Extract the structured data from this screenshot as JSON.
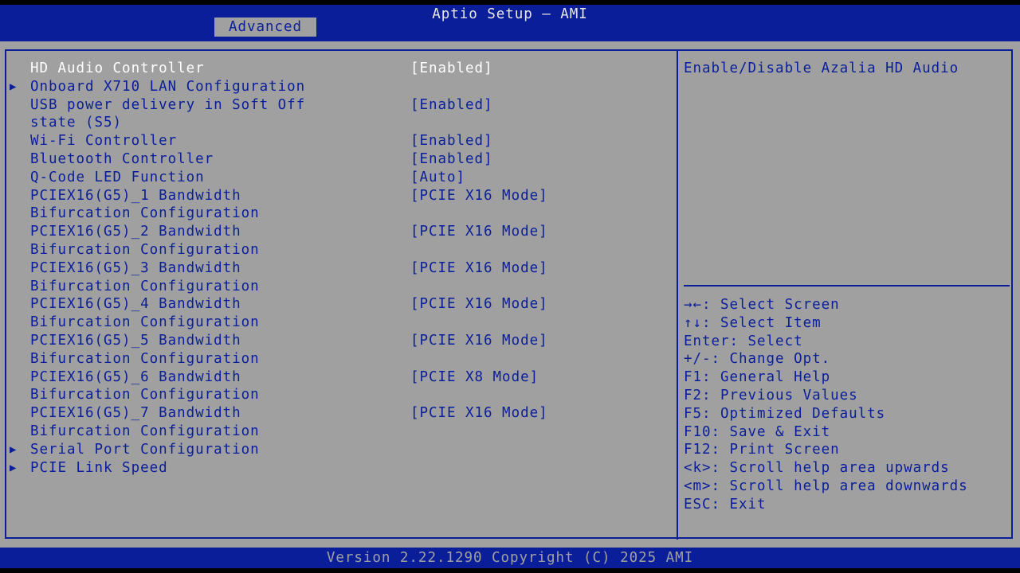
{
  "header": {
    "title": "Aptio Setup – AMI",
    "active_tab": "Advanced"
  },
  "menu": [
    {
      "label": "HD Audio Controller",
      "value": "[Enabled]",
      "selected": true
    },
    {
      "label": "Onboard X710 LAN Configuration",
      "submenu_arrow": "▶"
    },
    {
      "label": "USB power delivery in Soft Off",
      "label2": "state (S5)",
      "value": "[Enabled]"
    },
    {
      "label": "Wi-Fi Controller",
      "value": "[Enabled]"
    },
    {
      "label": "Bluetooth Controller",
      "value": "[Enabled]"
    },
    {
      "label": "Q-Code LED Function",
      "value": "[Auto]"
    },
    {
      "label": "PCIEX16(G5)_1 Bandwidth",
      "label2": "Bifurcation Configuration",
      "value": "[PCIE X16 Mode]"
    },
    {
      "label": "PCIEX16(G5)_2 Bandwidth",
      "label2": "Bifurcation Configuration",
      "value": "[PCIE X16 Mode]"
    },
    {
      "label": "PCIEX16(G5)_3 Bandwidth",
      "label2": "Bifurcation Configuration",
      "value": "[PCIE X16 Mode]"
    },
    {
      "label": "PCIEX16(G5)_4 Bandwidth",
      "label2": "Bifurcation Configuration",
      "value": "[PCIE X16 Mode]"
    },
    {
      "label": "PCIEX16(G5)_5 Bandwidth",
      "label2": "Bifurcation Configuration",
      "value": "[PCIE X16 Mode]"
    },
    {
      "label": "PCIEX16(G5)_6 Bandwidth",
      "label2": "Bifurcation Configuration",
      "value": "[PCIE X8 Mode]"
    },
    {
      "label": "PCIEX16(G5)_7 Bandwidth",
      "label2": "Bifurcation Configuration",
      "value": "[PCIE X16 Mode]"
    },
    {
      "label": "Serial Port Configuration",
      "submenu_arrow": "▶"
    },
    {
      "label": "PCIE Link Speed",
      "submenu_arrow": "▶"
    }
  ],
  "help": {
    "description": "Enable/Disable Azalia HD Audio",
    "keys": [
      "→←: Select Screen",
      "↑↓: Select Item",
      "Enter: Select",
      "+/-: Change Opt.",
      "F1: General Help",
      "F2: Previous Values",
      "F5: Optimized Defaults",
      "F10: Save & Exit",
      "F12: Print Screen",
      "<k>: Scroll help area upwards",
      "<m>: Scroll help area downwards",
      "ESC: Exit"
    ]
  },
  "footer": {
    "text": "Version 2.22.1290 Copyright (C) 2025 AMI"
  },
  "colors": {
    "header_blue": "#0a1e9a",
    "panel_gray": "#a0a0a0",
    "selected_text": "#ffffff"
  }
}
